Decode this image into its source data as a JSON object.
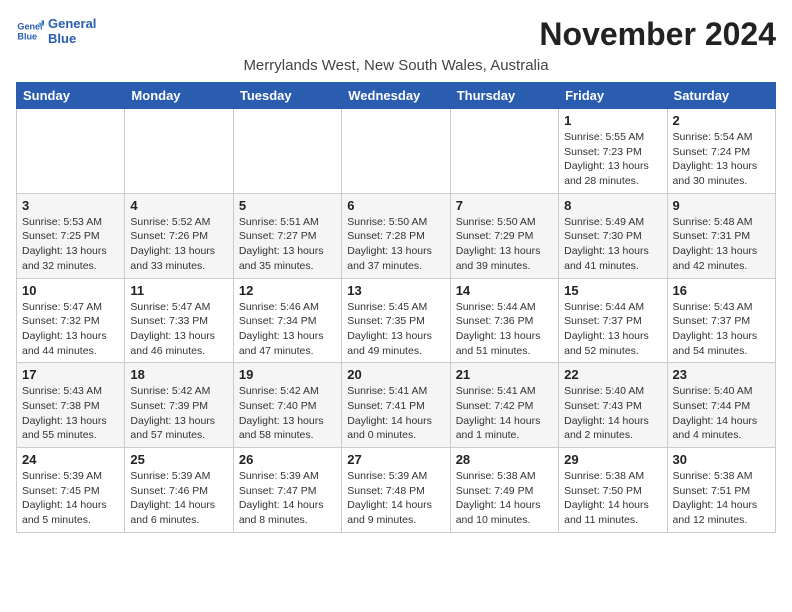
{
  "logo": {
    "line1": "General",
    "line2": "Blue"
  },
  "title": "November 2024",
  "subtitle": "Merrylands West, New South Wales, Australia",
  "days_of_week": [
    "Sunday",
    "Monday",
    "Tuesday",
    "Wednesday",
    "Thursday",
    "Friday",
    "Saturday"
  ],
  "weeks": [
    [
      {
        "num": "",
        "info": ""
      },
      {
        "num": "",
        "info": ""
      },
      {
        "num": "",
        "info": ""
      },
      {
        "num": "",
        "info": ""
      },
      {
        "num": "",
        "info": ""
      },
      {
        "num": "1",
        "info": "Sunrise: 5:55 AM\nSunset: 7:23 PM\nDaylight: 13 hours\nand 28 minutes."
      },
      {
        "num": "2",
        "info": "Sunrise: 5:54 AM\nSunset: 7:24 PM\nDaylight: 13 hours\nand 30 minutes."
      }
    ],
    [
      {
        "num": "3",
        "info": "Sunrise: 5:53 AM\nSunset: 7:25 PM\nDaylight: 13 hours\nand 32 minutes."
      },
      {
        "num": "4",
        "info": "Sunrise: 5:52 AM\nSunset: 7:26 PM\nDaylight: 13 hours\nand 33 minutes."
      },
      {
        "num": "5",
        "info": "Sunrise: 5:51 AM\nSunset: 7:27 PM\nDaylight: 13 hours\nand 35 minutes."
      },
      {
        "num": "6",
        "info": "Sunrise: 5:50 AM\nSunset: 7:28 PM\nDaylight: 13 hours\nand 37 minutes."
      },
      {
        "num": "7",
        "info": "Sunrise: 5:50 AM\nSunset: 7:29 PM\nDaylight: 13 hours\nand 39 minutes."
      },
      {
        "num": "8",
        "info": "Sunrise: 5:49 AM\nSunset: 7:30 PM\nDaylight: 13 hours\nand 41 minutes."
      },
      {
        "num": "9",
        "info": "Sunrise: 5:48 AM\nSunset: 7:31 PM\nDaylight: 13 hours\nand 42 minutes."
      }
    ],
    [
      {
        "num": "10",
        "info": "Sunrise: 5:47 AM\nSunset: 7:32 PM\nDaylight: 13 hours\nand 44 minutes."
      },
      {
        "num": "11",
        "info": "Sunrise: 5:47 AM\nSunset: 7:33 PM\nDaylight: 13 hours\nand 46 minutes."
      },
      {
        "num": "12",
        "info": "Sunrise: 5:46 AM\nSunset: 7:34 PM\nDaylight: 13 hours\nand 47 minutes."
      },
      {
        "num": "13",
        "info": "Sunrise: 5:45 AM\nSunset: 7:35 PM\nDaylight: 13 hours\nand 49 minutes."
      },
      {
        "num": "14",
        "info": "Sunrise: 5:44 AM\nSunset: 7:36 PM\nDaylight: 13 hours\nand 51 minutes."
      },
      {
        "num": "15",
        "info": "Sunrise: 5:44 AM\nSunset: 7:37 PM\nDaylight: 13 hours\nand 52 minutes."
      },
      {
        "num": "16",
        "info": "Sunrise: 5:43 AM\nSunset: 7:37 PM\nDaylight: 13 hours\nand 54 minutes."
      }
    ],
    [
      {
        "num": "17",
        "info": "Sunrise: 5:43 AM\nSunset: 7:38 PM\nDaylight: 13 hours\nand 55 minutes."
      },
      {
        "num": "18",
        "info": "Sunrise: 5:42 AM\nSunset: 7:39 PM\nDaylight: 13 hours\nand 57 minutes."
      },
      {
        "num": "19",
        "info": "Sunrise: 5:42 AM\nSunset: 7:40 PM\nDaylight: 13 hours\nand 58 minutes."
      },
      {
        "num": "20",
        "info": "Sunrise: 5:41 AM\nSunset: 7:41 PM\nDaylight: 14 hours\nand 0 minutes."
      },
      {
        "num": "21",
        "info": "Sunrise: 5:41 AM\nSunset: 7:42 PM\nDaylight: 14 hours\nand 1 minute."
      },
      {
        "num": "22",
        "info": "Sunrise: 5:40 AM\nSunset: 7:43 PM\nDaylight: 14 hours\nand 2 minutes."
      },
      {
        "num": "23",
        "info": "Sunrise: 5:40 AM\nSunset: 7:44 PM\nDaylight: 14 hours\nand 4 minutes."
      }
    ],
    [
      {
        "num": "24",
        "info": "Sunrise: 5:39 AM\nSunset: 7:45 PM\nDaylight: 14 hours\nand 5 minutes."
      },
      {
        "num": "25",
        "info": "Sunrise: 5:39 AM\nSunset: 7:46 PM\nDaylight: 14 hours\nand 6 minutes."
      },
      {
        "num": "26",
        "info": "Sunrise: 5:39 AM\nSunset: 7:47 PM\nDaylight: 14 hours\nand 8 minutes."
      },
      {
        "num": "27",
        "info": "Sunrise: 5:39 AM\nSunset: 7:48 PM\nDaylight: 14 hours\nand 9 minutes."
      },
      {
        "num": "28",
        "info": "Sunrise: 5:38 AM\nSunset: 7:49 PM\nDaylight: 14 hours\nand 10 minutes."
      },
      {
        "num": "29",
        "info": "Sunrise: 5:38 AM\nSunset: 7:50 PM\nDaylight: 14 hours\nand 11 minutes."
      },
      {
        "num": "30",
        "info": "Sunrise: 5:38 AM\nSunset: 7:51 PM\nDaylight: 14 hours\nand 12 minutes."
      }
    ]
  ]
}
